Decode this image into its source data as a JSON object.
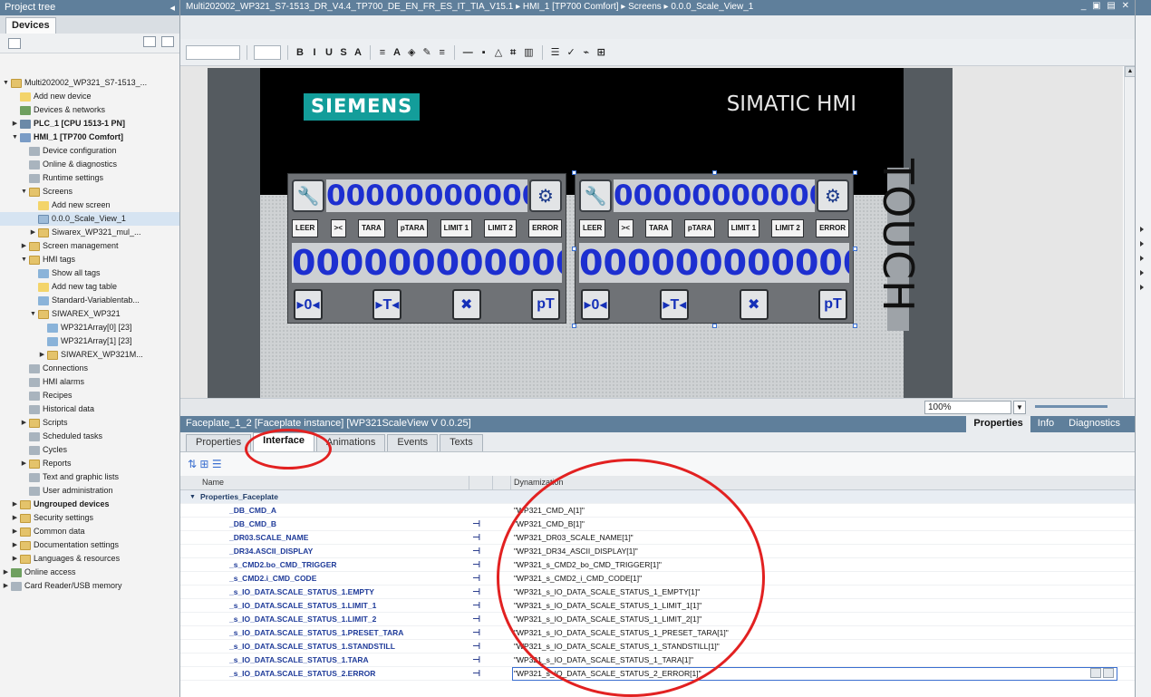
{
  "tree": {
    "title": "Project tree",
    "devices_tab": "Devices",
    "items": [
      {
        "label": "Multi202002_WP321_S7-1513_...",
        "indent": 0,
        "twisty": "▼",
        "icon": "fold",
        "bold": false
      },
      {
        "label": "Add new device",
        "indent": 1,
        "twisty": "",
        "icon": "add",
        "bold": false
      },
      {
        "label": "Devices & networks",
        "indent": 1,
        "twisty": "",
        "icon": "net",
        "bold": false
      },
      {
        "label": "PLC_1 [CPU 1513-1 PN]",
        "indent": 1,
        "twisty": "▶",
        "icon": "dev",
        "bold": true
      },
      {
        "label": "HMI_1 [TP700 Comfort]",
        "indent": 1,
        "twisty": "▼",
        "icon": "hmi",
        "bold": true
      },
      {
        "label": "Device configuration",
        "indent": 2,
        "twisty": "",
        "icon": "gen",
        "bold": false
      },
      {
        "label": "Online & diagnostics",
        "indent": 2,
        "twisty": "",
        "icon": "gen",
        "bold": false
      },
      {
        "label": "Runtime settings",
        "indent": 2,
        "twisty": "",
        "icon": "gen",
        "bold": false
      },
      {
        "label": "Screens",
        "indent": 2,
        "twisty": "▼",
        "icon": "fold",
        "bold": false
      },
      {
        "label": "Add new screen",
        "indent": 3,
        "twisty": "",
        "icon": "add",
        "bold": false
      },
      {
        "label": "0.0.0_Scale_View_1",
        "indent": 3,
        "twisty": "",
        "icon": "scr",
        "bold": false,
        "selected": true
      },
      {
        "label": "Siwarex_WP321_mul_...",
        "indent": 3,
        "twisty": "▶",
        "icon": "fold",
        "bold": false
      },
      {
        "label": "Screen management",
        "indent": 2,
        "twisty": "▶",
        "icon": "fold",
        "bold": false
      },
      {
        "label": "HMI tags",
        "indent": 2,
        "twisty": "▼",
        "icon": "fold",
        "bold": false
      },
      {
        "label": "Show all tags",
        "indent": 3,
        "twisty": "",
        "icon": "tag",
        "bold": false
      },
      {
        "label": "Add new tag table",
        "indent": 3,
        "twisty": "",
        "icon": "add",
        "bold": false
      },
      {
        "label": "Standard-Variablentab...",
        "indent": 3,
        "twisty": "",
        "icon": "tag",
        "bold": false
      },
      {
        "label": "SIWAREX_WP321",
        "indent": 3,
        "twisty": "▼",
        "icon": "fold",
        "bold": false
      },
      {
        "label": "WP321Array[0] [23]",
        "indent": 4,
        "twisty": "",
        "icon": "tag",
        "bold": false
      },
      {
        "label": "WP321Array[1] [23]",
        "indent": 4,
        "twisty": "",
        "icon": "tag",
        "bold": false
      },
      {
        "label": "SIWAREX_WP321M...",
        "indent": 4,
        "twisty": "▶",
        "icon": "fold",
        "bold": false
      },
      {
        "label": "Connections",
        "indent": 2,
        "twisty": "",
        "icon": "gen",
        "bold": false
      },
      {
        "label": "HMI alarms",
        "indent": 2,
        "twisty": "",
        "icon": "gen",
        "bold": false
      },
      {
        "label": "Recipes",
        "indent": 2,
        "twisty": "",
        "icon": "gen",
        "bold": false
      },
      {
        "label": "Historical data",
        "indent": 2,
        "twisty": "",
        "icon": "gen",
        "bold": false
      },
      {
        "label": "Scripts",
        "indent": 2,
        "twisty": "▶",
        "icon": "fold",
        "bold": false
      },
      {
        "label": "Scheduled tasks",
        "indent": 2,
        "twisty": "",
        "icon": "gen",
        "bold": false
      },
      {
        "label": "Cycles",
        "indent": 2,
        "twisty": "",
        "icon": "gen",
        "bold": false
      },
      {
        "label": "Reports",
        "indent": 2,
        "twisty": "▶",
        "icon": "fold",
        "bold": false
      },
      {
        "label": "Text and graphic lists",
        "indent": 2,
        "twisty": "",
        "icon": "gen",
        "bold": false
      },
      {
        "label": "User administration",
        "indent": 2,
        "twisty": "",
        "icon": "gen",
        "bold": false
      },
      {
        "label": "Ungrouped devices",
        "indent": 1,
        "twisty": "▶",
        "icon": "fold",
        "bold": true
      },
      {
        "label": "Security settings",
        "indent": 1,
        "twisty": "▶",
        "icon": "fold",
        "bold": false
      },
      {
        "label": "Common data",
        "indent": 1,
        "twisty": "▶",
        "icon": "fold",
        "bold": false
      },
      {
        "label": "Documentation settings",
        "indent": 1,
        "twisty": "▶",
        "icon": "fold",
        "bold": false
      },
      {
        "label": "Languages & resources",
        "indent": 1,
        "twisty": "▶",
        "icon": "fold",
        "bold": false
      },
      {
        "label": "Online access",
        "indent": 0,
        "twisty": "▶",
        "icon": "net",
        "bold": false
      },
      {
        "label": "Card Reader/USB memory",
        "indent": 0,
        "twisty": "▶",
        "icon": "gen",
        "bold": false
      }
    ]
  },
  "editor": {
    "breadcrumb": "Multi202002_WP321_S7-1513_DR_V4.4_TP700_DE_EN_FR_ES_IT_TIA_V15.1  ▸  HMI_1 [TP700 Comfort]  ▸  Screens  ▸  0.0.0_Scale_View_1",
    "window_controls": "_ ▣ ▤ ✕",
    "format_buttons": [
      "B",
      "I",
      "U",
      "S",
      "A",
      "≡",
      "A",
      "◈",
      "✎",
      "≡",
      "—",
      "▪",
      "△",
      "⌗",
      "▥",
      "☰",
      "✓",
      "⌁",
      "⊞"
    ]
  },
  "hmi": {
    "brand": "SIEMENS",
    "model": "SIMATIC HMI",
    "touch": "TOUCH",
    "faceplates": [
      {
        "small_value": "00000000000(",
        "big_value": "000000000000(",
        "status": [
          "LEER",
          "><",
          "TARA",
          "pTARA",
          "LIMIT 1",
          "LIMIT 2",
          "ERROR"
        ],
        "actions": [
          "▸0◂",
          "▸T◂",
          "✖",
          "pT"
        ]
      },
      {
        "small_value": "00000000000(",
        "big_value": "000000000000(",
        "status": [
          "LEER",
          "><",
          "TARA",
          "pTARA",
          "LIMIT 1",
          "LIMIT 2",
          "ERROR"
        ],
        "actions": [
          "▸0◂",
          "▸T◂",
          "✖",
          "pT"
        ]
      }
    ]
  },
  "zoom": {
    "value": "100%"
  },
  "properties": {
    "title": "Faceplate_1_2 [Faceplate instance] [WP321ScaleView V 0.0.25]",
    "top_tabs": [
      "Properties",
      "Info",
      "Diagnostics"
    ],
    "active_top_tab": "Properties",
    "sub_tabs": [
      "Properties",
      "Interface",
      "Animations",
      "Events",
      "Texts"
    ],
    "active_sub_tab": "Interface",
    "column_name": "Name",
    "column_dynamization": "Dynamization",
    "group_label": "Properties_Faceplate",
    "rows": [
      {
        "name": "_DB_CMD_A",
        "dyn": "\"WP321_CMD_A[1]\"",
        "linked": false
      },
      {
        "name": "_DB_CMD_B",
        "dyn": "\"WP321_CMD_B[1]\"",
        "linked": true
      },
      {
        "name": "_DR03.SCALE_NAME",
        "dyn": "\"WP321_DR03_SCALE_NAME[1]\"",
        "linked": true
      },
      {
        "name": "_DR34.ASCII_DISPLAY",
        "dyn": "\"WP321_DR34_ASCII_DISPLAY[1]\"",
        "linked": true
      },
      {
        "name": "_s_CMD2.bo_CMD_TRIGGER",
        "dyn": "\"WP321_s_CMD2_bo_CMD_TRIGGER[1]\"",
        "linked": true
      },
      {
        "name": "_s_CMD2.i_CMD_CODE",
        "dyn": "\"WP321_s_CMD2_i_CMD_CODE[1]\"",
        "linked": true
      },
      {
        "name": "_s_IO_DATA.SCALE_STATUS_1.EMPTY",
        "dyn": "\"WP321_s_IO_DATA_SCALE_STATUS_1_EMPTY[1]\"",
        "linked": true
      },
      {
        "name": "_s_IO_DATA.SCALE_STATUS_1.LIMIT_1",
        "dyn": "\"WP321_s_IO_DATA_SCALE_STATUS_1_LIMIT_1[1]\"",
        "linked": true
      },
      {
        "name": "_s_IO_DATA.SCALE_STATUS_1.LIMIT_2",
        "dyn": "\"WP321_s_IO_DATA_SCALE_STATUS_1_LIMIT_2[1]\"",
        "linked": true
      },
      {
        "name": "_s_IO_DATA.SCALE_STATUS_1.PRESET_TARA",
        "dyn": "\"WP321_s_IO_DATA_SCALE_STATUS_1_PRESET_TARA[1]\"",
        "linked": true
      },
      {
        "name": "_s_IO_DATA.SCALE_STATUS_1.STANDSTILL",
        "dyn": "\"WP321_s_IO_DATA_SCALE_STATUS_1_STANDSTILL[1]\"",
        "linked": true
      },
      {
        "name": "_s_IO_DATA.SCALE_STATUS_1.TARA",
        "dyn": "\"WP321_s_IO_DATA_SCALE_STATUS_1_TARA[1]\"",
        "linked": true
      },
      {
        "name": "_s_IO_DATA.SCALE_STATUS_2.ERROR",
        "dyn": "\"WP321_s_IO_DATA_SCALE_STATUS_2_ERROR[1]\"",
        "linked": true,
        "editing": true
      }
    ]
  },
  "colors": {
    "title_bar": "#5f7f9b",
    "hmi_value_blue": "#1d2fd0",
    "siemens_teal": "#139d9a",
    "annotation_red": "#e22121"
  }
}
